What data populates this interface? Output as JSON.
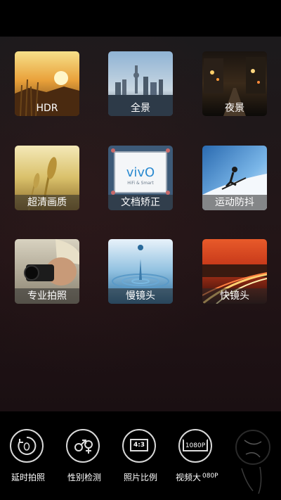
{
  "modes": [
    {
      "label": "HDR"
    },
    {
      "label": "全景"
    },
    {
      "label": "夜景"
    },
    {
      "label": "超清画质"
    },
    {
      "label": "文档矫正",
      "logo_text": "vivO",
      "logo_sub": "HiFi & Smart"
    },
    {
      "label": "运动防抖"
    },
    {
      "label": "专业拍照"
    },
    {
      "label": "慢镜头"
    },
    {
      "label": "快镜头"
    }
  ],
  "controls": [
    {
      "label": "延时拍照",
      "icon": "timer-icon"
    },
    {
      "label": "性别检测",
      "icon": "gender-icon"
    },
    {
      "label": "照片比例",
      "icon": "aspect-ratio-icon",
      "icon_text": "4:3"
    },
    {
      "label": "视频大",
      "icon": "video-resolution-icon",
      "icon_text": "1080P",
      "overlay_text": "080P"
    }
  ]
}
